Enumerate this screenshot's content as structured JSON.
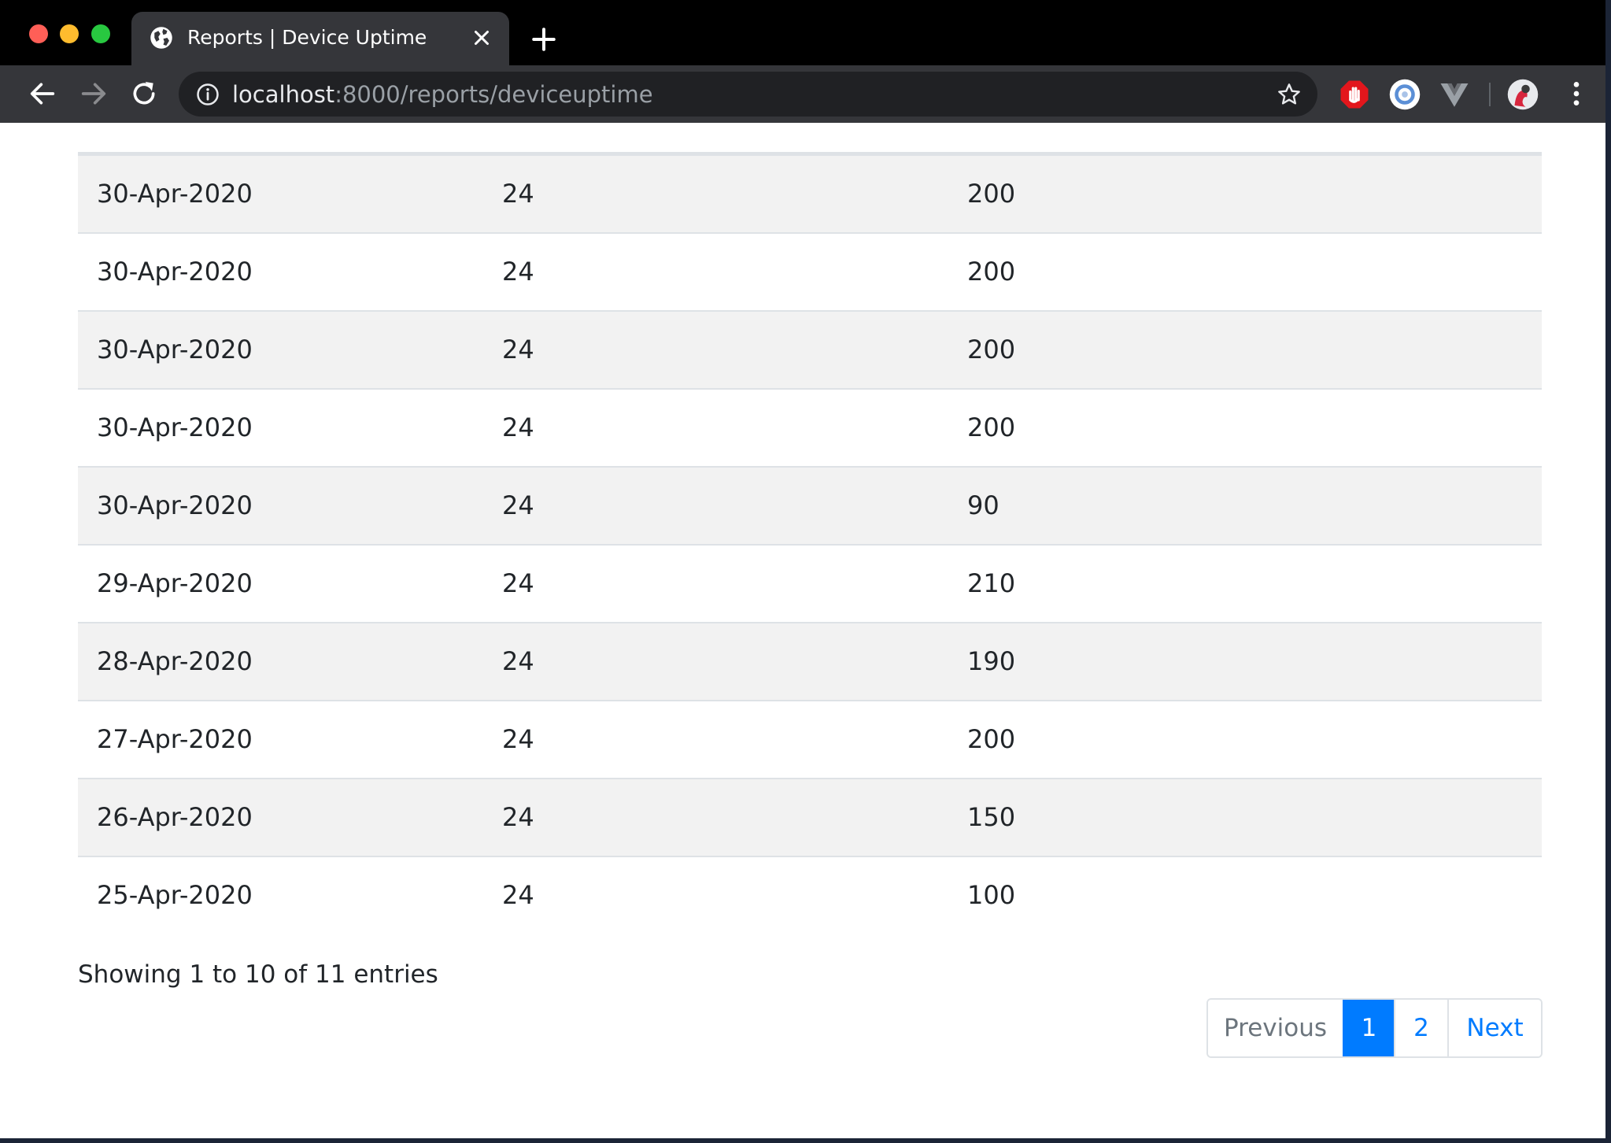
{
  "browser": {
    "tab": {
      "title": "Reports | Device Uptime"
    },
    "address": {
      "host": "localhost",
      "path": ":8000/reports/deviceuptime"
    }
  },
  "table": {
    "rows": [
      {
        "date": "30-Apr-2020",
        "hours": "24",
        "uptime": "200"
      },
      {
        "date": "30-Apr-2020",
        "hours": "24",
        "uptime": "200"
      },
      {
        "date": "30-Apr-2020",
        "hours": "24",
        "uptime": "200"
      },
      {
        "date": "30-Apr-2020",
        "hours": "24",
        "uptime": "200"
      },
      {
        "date": "30-Apr-2020",
        "hours": "24",
        "uptime": "90"
      },
      {
        "date": "29-Apr-2020",
        "hours": "24",
        "uptime": "210"
      },
      {
        "date": "28-Apr-2020",
        "hours": "24",
        "uptime": "190"
      },
      {
        "date": "27-Apr-2020",
        "hours": "24",
        "uptime": "200"
      },
      {
        "date": "26-Apr-2020",
        "hours": "24",
        "uptime": "150"
      },
      {
        "date": "25-Apr-2020",
        "hours": "24",
        "uptime": "100"
      }
    ]
  },
  "footer": {
    "info": "Showing 1 to 10 of 11 entries",
    "pagination": {
      "previous": "Previous",
      "pages": [
        "1",
        "2"
      ],
      "next": "Next"
    }
  },
  "colors": {
    "primary": "#007bff",
    "stripe": "#f2f2f2",
    "border": "#dee2e6"
  }
}
